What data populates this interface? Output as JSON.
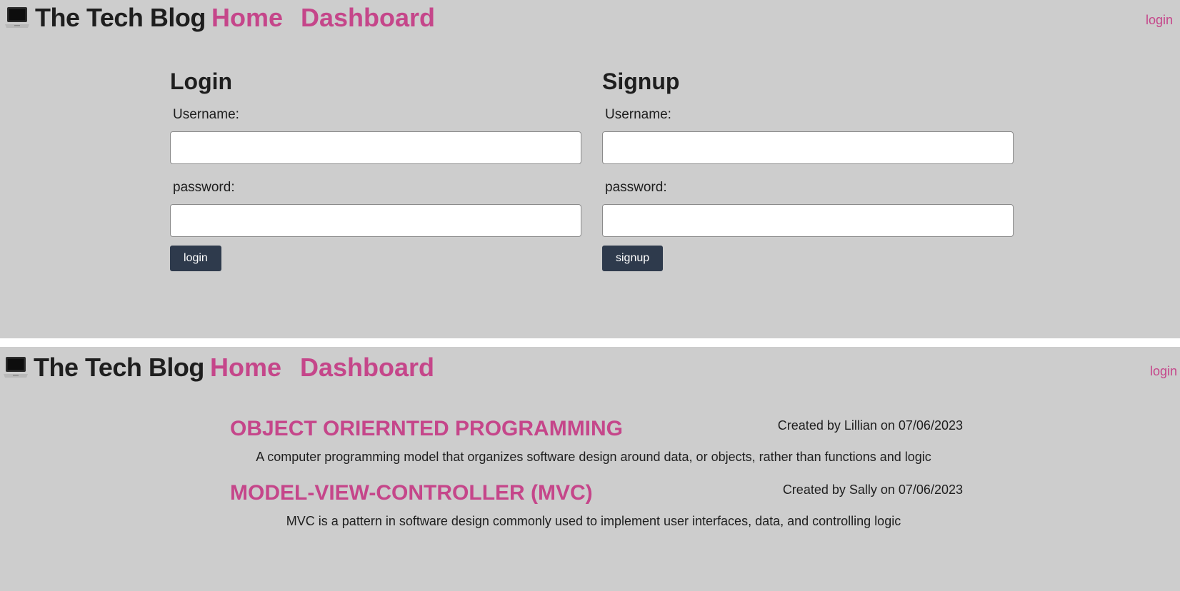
{
  "colors": {
    "accent": "#c5468a",
    "panel_bg": "#cdcdcd",
    "button_bg": "#2e3a4c",
    "text": "#1e1e1e"
  },
  "header": {
    "logo_icon": "laptop-icon",
    "brand": "The Tech Blog",
    "nav_home": "Home",
    "nav_dashboard": "Dashboard",
    "login_link": "login"
  },
  "login_form": {
    "title": "Login",
    "username_label": "Username:",
    "username_value": "",
    "password_label": "password:",
    "password_value": "",
    "submit_label": "login"
  },
  "signup_form": {
    "title": "Signup",
    "username_label": "Username:",
    "username_value": "",
    "password_label": "password:",
    "password_value": "",
    "submit_label": "signup"
  },
  "posts": [
    {
      "title": "OBJECT ORIERNTED PROGRAMMING",
      "meta": "Created by Lillian on 07/06/2023",
      "body": "A computer programming model that organizes software design around data, or objects, rather than functions and logic"
    },
    {
      "title": "MODEL-VIEW-CONTROLLER (MVC)",
      "meta": "Created by Sally on 07/06/2023",
      "body": "MVC is a pattern in software design commonly used to implement user interfaces, data, and controlling logic"
    }
  ]
}
